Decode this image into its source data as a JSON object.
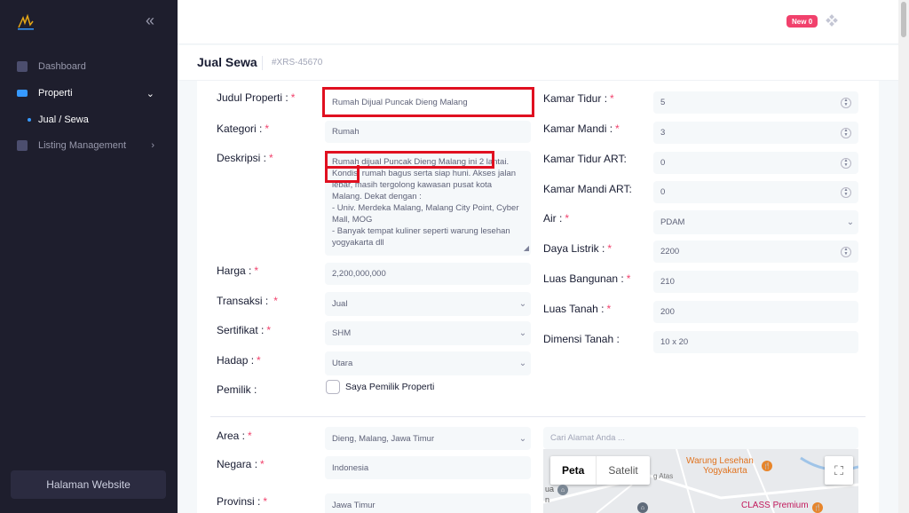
{
  "sidebar": {
    "items": [
      {
        "label": "Dashboard"
      },
      {
        "label": "Properti"
      },
      {
        "label": "Listing Management"
      }
    ],
    "sub_item": "Jual / Sewa",
    "website_button": "Halaman Website"
  },
  "header": {
    "badge_label": "New",
    "badge_count": "0"
  },
  "page": {
    "title": "Jual Sewa",
    "code": "#XRS-45670"
  },
  "form": {
    "judul_label": "Judul Properti :",
    "judul_value": "Rumah Dijual Puncak Dieng Malang",
    "kategori_label": "Kategori :",
    "kategori_value": "Rumah",
    "deskripsi_label": "Deskripsi :",
    "deskripsi_value": "Rumah dijual Puncak Dieng Malang ini 2 lantai. Kondisi rumah bagus serta siap huni. Akses jalan lebar, masih tergolong kawasan pusat kota Malang. Dekat dengan :\n- Univ. Merdeka Malang, Malang City Point, Cyber Mall, MOG\n- Banyak tempat kuliner seperti warung lesehan yogyakarta dll",
    "harga_label": "Harga :",
    "harga_value": "2,200,000,000",
    "transaksi_label": "Transaksi :",
    "transaksi_value": "Jual",
    "sertifikat_label": "Sertifikat :",
    "sertifikat_value": "SHM",
    "hadap_label": "Hadap :",
    "hadap_value": "Utara",
    "pemilik_label": "Pemilik :",
    "pemilik_checkbox": "Saya Pemilik Properti",
    "kamar_tidur_label": "Kamar Tidur :",
    "kamar_tidur_value": "5",
    "kamar_mandi_label": "Kamar Mandi :",
    "kamar_mandi_value": "3",
    "kamar_tidur_art_label": "Kamar Tidur ART:",
    "kamar_tidur_art_value": "0",
    "kamar_mandi_art_label": "Kamar Mandi ART:",
    "kamar_mandi_art_value": "0",
    "air_label": "Air :",
    "air_value": "PDAM",
    "daya_label": "Daya Listrik :",
    "daya_value": "2200",
    "luas_bangunan_label": "Luas Bangunan :",
    "luas_bangunan_value": "210",
    "luas_tanah_label": "Luas Tanah :",
    "luas_tanah_value": "200",
    "dimensi_label": "Dimensi Tanah :",
    "dimensi_value": "10 x 20",
    "area_label": "Area :",
    "area_value": "Dieng, Malang, Jawa Timur",
    "negara_label": "Negara :",
    "negara_value": "Indonesia",
    "provinsi_label": "Provinsi :",
    "provinsi_value": "Jawa Timur",
    "required_mark": "*"
  },
  "map": {
    "search_placeholder": "Cari Alamat Anda ...",
    "type_map": "Peta",
    "type_satellite": "Satelit",
    "poi_1": "Warung Lesehan",
    "poi_1b": "Yogyakarta",
    "poi_2": "CLASS Premium",
    "road_label": "g Atas",
    "side_label_1": "ua",
    "side_label_2": "n"
  },
  "colors": {
    "sidebar_bg": "#1e1e2d",
    "accent": "#3699ff",
    "required": "#f1416c",
    "highlight_box": "#e01020"
  }
}
